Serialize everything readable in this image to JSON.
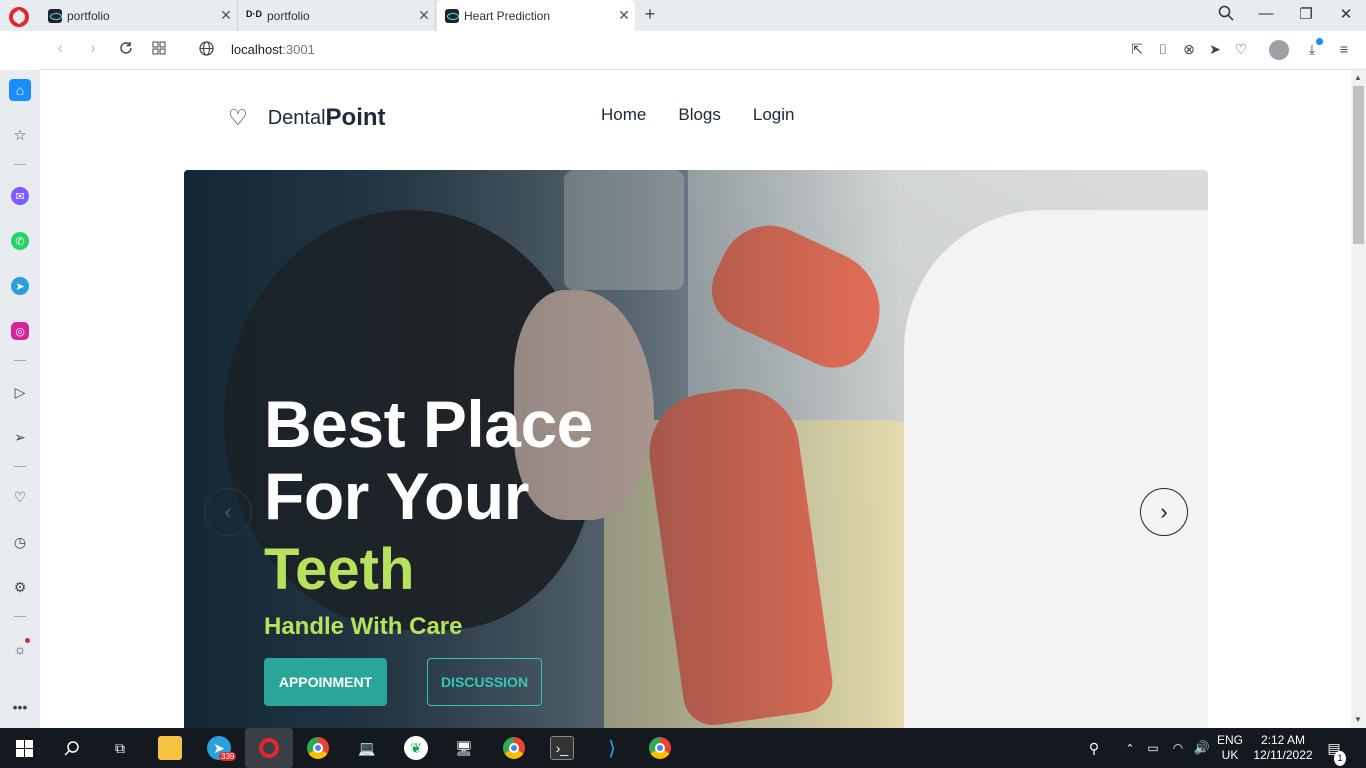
{
  "browser": {
    "tabs": [
      {
        "title": "portfolio",
        "icon": "react-icon",
        "active": false
      },
      {
        "title": "portfolio",
        "icon": "ym-icon",
        "active": false
      },
      {
        "title": "Heart Prediction",
        "icon": "react-icon",
        "active": true
      }
    ],
    "ym_glyph": "D·D",
    "new_tab": "+",
    "url_host": "localhost",
    "url_port": ":3001"
  },
  "site": {
    "brand_light": "Dental",
    "brand_bold": "Point",
    "nav": [
      "Home",
      "Blogs",
      "Login"
    ]
  },
  "hero": {
    "title_line1": "Best Place",
    "title_line2": "For Your",
    "title_accent": "Teeth",
    "subtitle": "Handle With Care",
    "primary_button": "APPOINMENT",
    "secondary_button": "DISCUSSION",
    "prev_arrow": "‹",
    "next_arrow": "›",
    "accent_color": "#b7e25e",
    "button_color": "#2aa599"
  },
  "taskbar": {
    "telegram_badge": "339",
    "lang_line1": "ENG",
    "lang_line2": "UK",
    "time": "2:12 AM",
    "date": "12/11/2022",
    "notification_count": "1"
  }
}
